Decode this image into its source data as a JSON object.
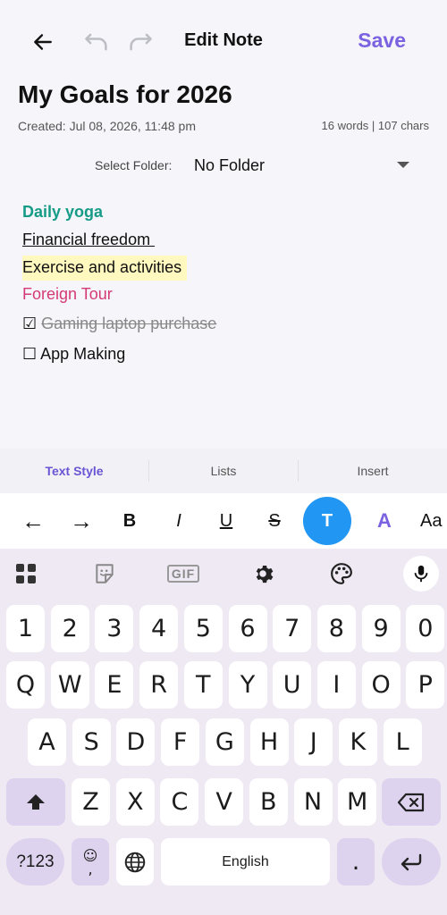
{
  "topbar": {
    "title": "Edit Note",
    "save_label": "Save"
  },
  "note": {
    "title": "My Goals for 2026",
    "created": "Created: Jul 08, 2026, 11:48 pm",
    "counts": "16 words | 107 chars",
    "folder_label": "Select Folder:",
    "folder_value": "No Folder",
    "lines": [
      {
        "text": "Daily yoga",
        "style": "bold-teal",
        "color": "#169b87"
      },
      {
        "text": "Financial freedom ",
        "style": "underline"
      },
      {
        "text": "Exercise and activities",
        "style": "highlight",
        "color": "#fff8bf"
      },
      {
        "text": "Foreign Tour",
        "style": "pink",
        "color": "#d43a77"
      },
      {
        "checkbox": "☑",
        "text": "Gaming laptop purchase",
        "style": "strikethrough-checked"
      },
      {
        "checkbox": "☐",
        "text": "App Making",
        "style": "unchecked"
      }
    ]
  },
  "tabs": [
    {
      "label": "Text Style",
      "active": true
    },
    {
      "label": "Lists",
      "active": false
    },
    {
      "label": "Insert",
      "active": false
    }
  ],
  "format_toolbar": {
    "left_arrow": "←",
    "right_arrow": "→",
    "bold": "B",
    "italic": "I",
    "underline": "U",
    "strike": "S",
    "text_color": "T",
    "highlight": "A",
    "size": "Aa",
    "text_color_bg": "#2196f3",
    "accent": "#7b62e0"
  },
  "keyboard": {
    "tools": [
      "apps-grid-icon",
      "sticker-icon",
      "gif-icon",
      "settings-gear-icon",
      "palette-icon",
      "microphone-icon"
    ],
    "gif_label": "GIF",
    "row_numbers": [
      "1",
      "2",
      "3",
      "4",
      "5",
      "6",
      "7",
      "8",
      "9",
      "0"
    ],
    "row_top": [
      "Q",
      "W",
      "E",
      "R",
      "T",
      "Y",
      "U",
      "I",
      "O",
      "P"
    ],
    "row_mid": [
      "A",
      "S",
      "D",
      "F",
      "G",
      "H",
      "J",
      "K",
      "L"
    ],
    "row_bottom": [
      "Z",
      "X",
      "C",
      "V",
      "B",
      "N",
      "M"
    ],
    "symbols_label": "?123",
    "emoji_comma_top": "☺",
    "emoji_comma_bottom": ",",
    "space_label": "English",
    "period_label": "."
  }
}
